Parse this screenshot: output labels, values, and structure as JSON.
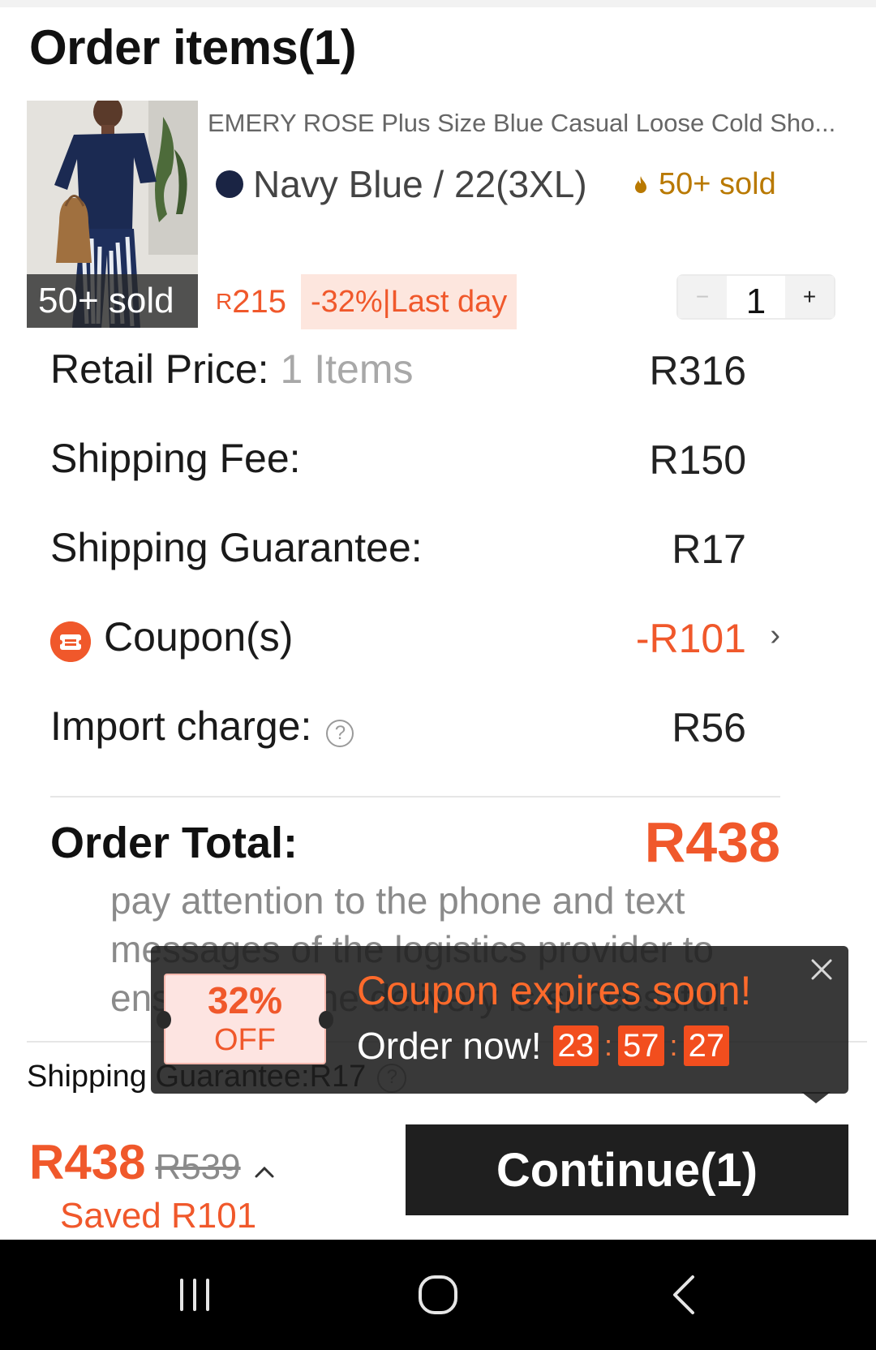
{
  "header": {
    "title": "Order items(1)"
  },
  "product": {
    "name": "EMERY ROSE Plus Size Blue Casual Loose Cold Sho...",
    "variant": "Navy Blue / 22(3XL)",
    "variant_color": "#1a2444",
    "hot_badge": "50+ sold",
    "thumb_badge": "50+ sold",
    "price_currency": "R",
    "price_value": "215",
    "discount_tag": "-32%|Last day",
    "quantity": "1",
    "qty_minus": "−",
    "qty_plus": "+"
  },
  "summary": {
    "retail_label": "Retail Price:",
    "retail_items": "1 Items",
    "retail_value": "R316",
    "shipping_label": "Shipping Fee:",
    "shipping_value": "R150",
    "guarantee_label": "Shipping Guarantee:",
    "guarantee_value": "R17",
    "coupon_label": "Coupon(s)",
    "coupon_value": "-R101",
    "import_label": "Import charge:",
    "import_value": "R56",
    "total_label": "Order Total:",
    "total_value": "R438"
  },
  "note": "pay attention to the phone and text messages of the logistics provider to ensure that the delivery is successful.",
  "guarantee_line": "Shipping Guarantee:R17",
  "popup": {
    "ticket_pct": "32%",
    "ticket_off": "OFF",
    "title": "Coupon expires soon!",
    "cta": "Order now!",
    "timer": [
      "23",
      "57",
      "27"
    ]
  },
  "bottom": {
    "price_now": "R438",
    "price_old": "R539",
    "saved": "Saved R101",
    "continue": "Continue(1)"
  },
  "colors": {
    "accent": "#f0582b",
    "gold": "#b97900",
    "dark": "#1f1f1f"
  }
}
